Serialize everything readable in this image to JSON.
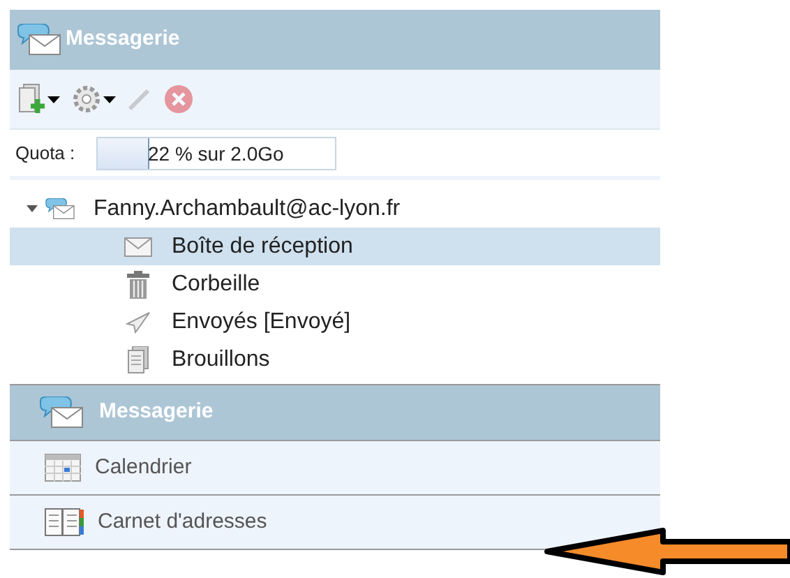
{
  "header": {
    "title": "Messagerie"
  },
  "toolbar": {
    "buttons": [
      {
        "kind": "new",
        "disabled": false,
        "dropdown": true
      },
      {
        "kind": "settings",
        "disabled": false,
        "dropdown": true
      },
      {
        "kind": "edit",
        "disabled": true,
        "dropdown": false
      },
      {
        "kind": "delete",
        "disabled": true,
        "dropdown": false
      }
    ]
  },
  "quota": {
    "label": "Quota :",
    "text": "22 % sur 2.0Go",
    "level": 0.22
  },
  "account": {
    "name": "Fanny.Archambault@ac-lyon.fr",
    "expanded": true,
    "children": [
      {
        "kind": "inbox",
        "label": "Boîte de réception",
        "selected": true
      },
      {
        "kind": "trash",
        "label": "Corbeille",
        "selected": false
      },
      {
        "kind": "sent",
        "label": "Envoyés [Envoyé]",
        "selected": false
      },
      {
        "kind": "drafts",
        "label": "Brouillons",
        "selected": false
      }
    ]
  },
  "nav": [
    {
      "kind": "mail",
      "label": "Messagerie",
      "selected": true
    },
    {
      "kind": "calendar",
      "label": "Calendrier",
      "selected": false
    },
    {
      "kind": "contacts",
      "label": "Carnet d'adresses",
      "selected": false
    }
  ],
  "pointer": {
    "kind": "arrow"
  }
}
